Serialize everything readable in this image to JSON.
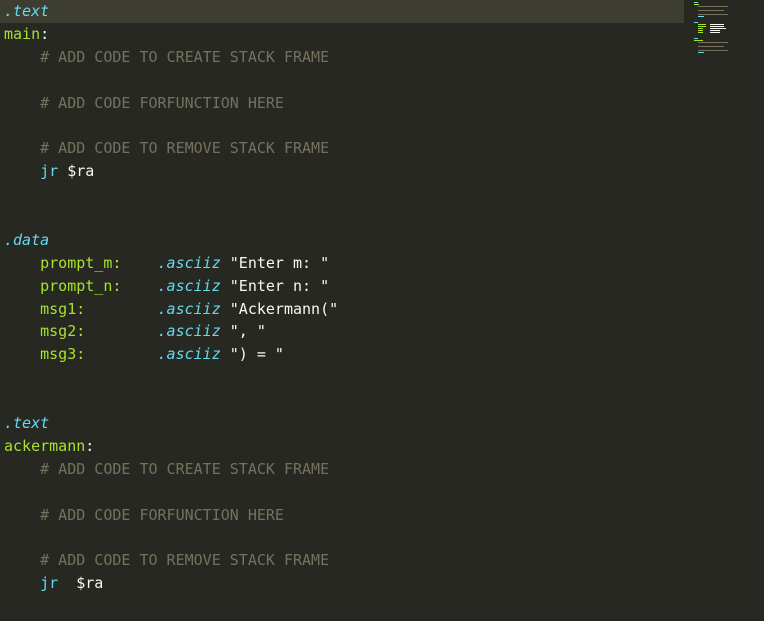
{
  "editor": {
    "language": "MIPS assembly",
    "theme_colors": {
      "background": "#272822",
      "current_line": "#3e3d32",
      "directive": "#66d9ef",
      "label": "#a6e22e",
      "comment": "#75715e",
      "text": "#f8f8f2"
    },
    "tokens": {
      "text_dir_1": ".text",
      "main_label": "main",
      "colon": ":",
      "c_create_1": "# ADD CODE TO CREATE STACK FRAME",
      "c_func_1": "# ADD CODE FORFUNCTION HERE",
      "c_remove_1": "# ADD CODE TO REMOVE STACK FRAME",
      "jr_1": "jr",
      "ra_1": "$ra",
      "data_dir": ".data",
      "prompt_m": "prompt_m:",
      "prompt_n": "prompt_n:",
      "msg1": "msg1:",
      "msg2": "msg2:",
      "msg3": "msg3:",
      "asciiz": ".asciiz",
      "str_prompt_m": "\"Enter m: \"",
      "str_prompt_n": "\"Enter n: \"",
      "str_msg1": "\"Ackermann(\"",
      "str_msg2": "\", \"",
      "str_msg3": "\") = \"",
      "text_dir_2": ".text",
      "ackermann_label": "ackermann",
      "c_create_2": "# ADD CODE TO CREATE STACK FRAME",
      "c_func_2": "# ADD CODE FORFUNCTION HERE",
      "c_remove_2": "# ADD CODE TO REMOVE STACK FRAME",
      "jr_2": "jr",
      "ra_2": "$ra"
    }
  }
}
